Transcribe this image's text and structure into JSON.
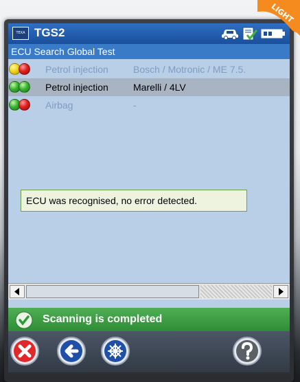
{
  "titlebar": {
    "title": "TGS2",
    "logo_text": "TEXA",
    "status_icons": [
      "car-icon",
      "document-check-icon",
      "battery-icon"
    ]
  },
  "badge": {
    "text": "LIGHT",
    "color": "#f58a1f"
  },
  "subtitle": "ECU Search Global Test",
  "ecu_list": [
    {
      "lamps": [
        "yellow",
        "red"
      ],
      "name": "Petrol injection",
      "system": "Bosch / Motronic / ME 7.5.",
      "state": "dim"
    },
    {
      "lamps": [
        "green",
        "green"
      ],
      "name": "Petrol injection",
      "system": "Marelli / 4LV",
      "state": "selected"
    },
    {
      "lamps": [
        "green",
        "red"
      ],
      "name": "Airbag",
      "system": "-",
      "state": "dim"
    }
  ],
  "message": "ECU was recognised, no error detected.",
  "status": {
    "text": "Scanning is completed",
    "color": "#3a9d41"
  },
  "toolbar": {
    "buttons": [
      "cancel-icon",
      "back-arrow-icon",
      "scan-icon",
      "help-icon"
    ]
  },
  "colors": {
    "titlebar": "#1f5aa8",
    "screen_bg": "#b9cfe7",
    "message_border": "#6fa34a"
  }
}
